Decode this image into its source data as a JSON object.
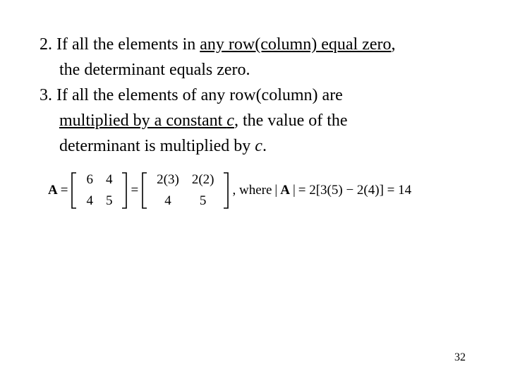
{
  "items": [
    {
      "number": "2.",
      "pre": " If all the elements in ",
      "ul1": "any row(column) equal zero",
      "post1": ",",
      "line2": "the determinant equals zero."
    },
    {
      "number": "3.",
      "pre": " If all the elements of any row(column) are",
      "ul1": "multiplied  by a constant ",
      "ul1_italic": "c",
      "post_ul": ", the value of the ",
      "line3a": "determinant is multiplied by ",
      "line3b_italic": "c",
      "line3c": "."
    }
  ],
  "equation": {
    "A_label": "A",
    "eq": "=",
    "m1": {
      "a": "6",
      "b": "4",
      "c": "4",
      "d": "5"
    },
    "m2": {
      "a": "2(3)",
      "b": "2(2)",
      "c": "4",
      "d": "5"
    },
    "where": ", where",
    "detA_pre": "| ",
    "detA": "A",
    "detA_post": " |",
    "rhs": "= 2[3(5) − 2(4)] = 14"
  },
  "page": "32"
}
